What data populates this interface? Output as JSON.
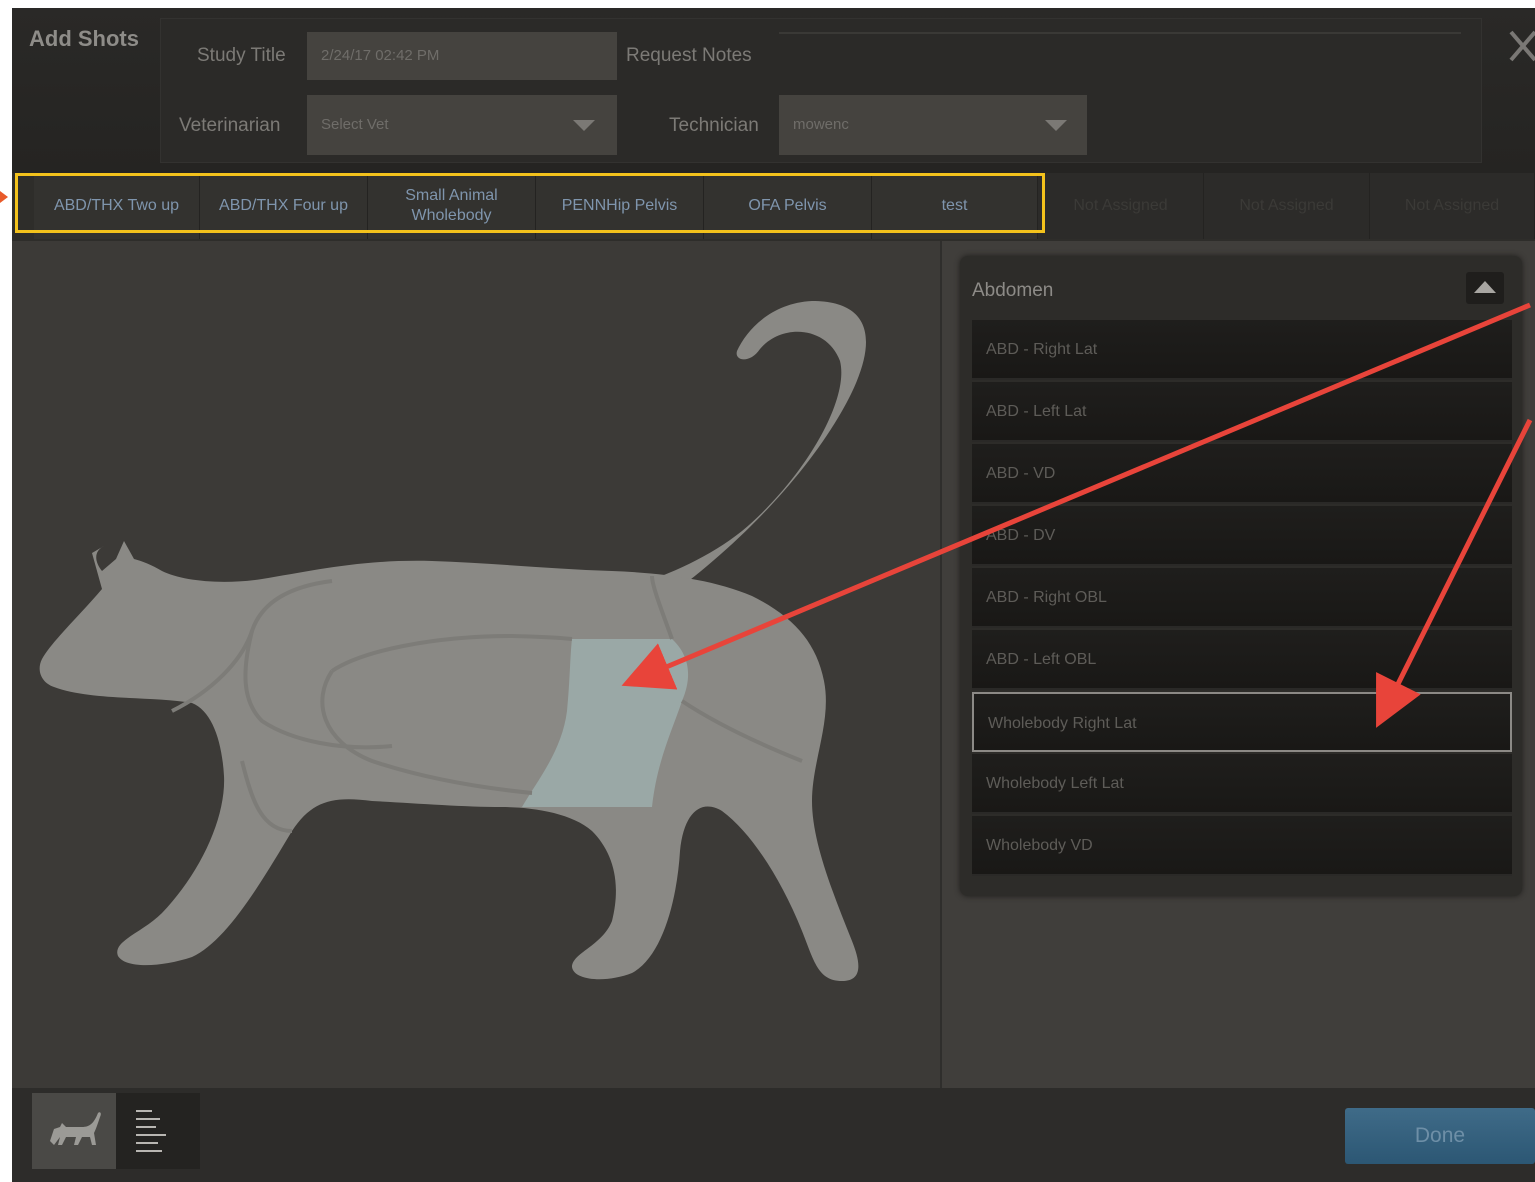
{
  "dialog": {
    "title": "Add Shots",
    "close_icon": "close-icon"
  },
  "form": {
    "study_title_label": "Study Title",
    "study_title_value": "2/24/17 02:42 PM",
    "request_notes_label": "Request Notes",
    "request_notes_value": "",
    "veterinarian_label": "Veterinarian",
    "veterinarian_value": "Select Vet",
    "technician_label": "Technician",
    "technician_value": "mowenc"
  },
  "tabs": [
    {
      "label": "ABD/THX Two up"
    },
    {
      "label": "ABD/THX Four up"
    },
    {
      "label": "Small Animal Wholebody"
    },
    {
      "label": "PENNHip Pelvis"
    },
    {
      "label": "OFA Pelvis"
    },
    {
      "label": "test"
    },
    {
      "label": "Not Assigned"
    },
    {
      "label": "Not Assigned"
    },
    {
      "label": "Not Assigned"
    }
  ],
  "anatomy": {
    "animal": "cat",
    "selected_region": "abdomen",
    "highlight_color": "#9aa8a6",
    "body_color": "#8a8985"
  },
  "panel": {
    "title": "Abdomen",
    "collapse_icon": "chevron-up-icon",
    "items": [
      {
        "label": "ABD - Right Lat"
      },
      {
        "label": "ABD - Left Lat"
      },
      {
        "label": "ABD - VD"
      },
      {
        "label": "ABD - DV"
      },
      {
        "label": "ABD - Right OBL"
      },
      {
        "label": "ABD - Left OBL"
      },
      {
        "label": "Wholebody Right Lat",
        "selected": true
      },
      {
        "label": "Wholebody Left Lat"
      },
      {
        "label": "Wholebody VD"
      }
    ]
  },
  "footer": {
    "anatomy_view_icon": "cat-icon",
    "list_view_icon": "list-icon",
    "done_label": "Done"
  },
  "annotations": {
    "highlight_box_color": "#f3c21c",
    "arrow_color": "#e8443a"
  }
}
